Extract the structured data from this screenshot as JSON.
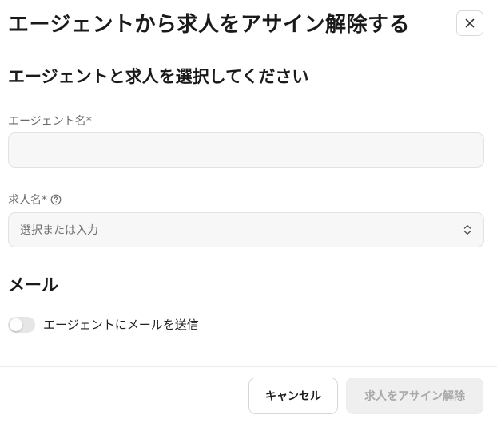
{
  "dialog": {
    "title": "エージェントから求人をアサイン解除する",
    "close_icon": "close-icon"
  },
  "selection_section": {
    "heading": "エージェントと求人を選択してください",
    "agent_field": {
      "label": "エージェント名*",
      "value": "",
      "placeholder": ""
    },
    "job_field": {
      "label": "求人名*",
      "help_icon": "question-circle-icon",
      "placeholder": "選択または入力",
      "indicator_icon": "chevron-up-down-icon"
    }
  },
  "email_section": {
    "heading": "メール",
    "toggle": {
      "label": "エージェントにメールを送信",
      "enabled": false
    }
  },
  "footer": {
    "cancel_label": "キャンセル",
    "submit_label": "求人をアサイン解除",
    "submit_disabled": true
  }
}
